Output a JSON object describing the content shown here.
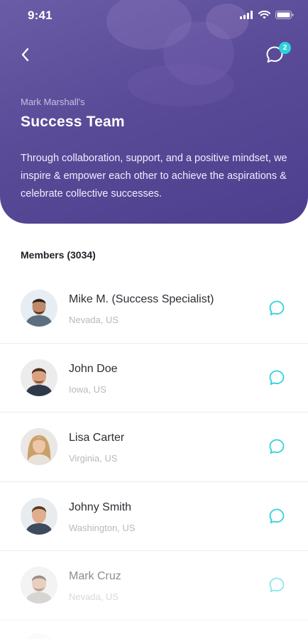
{
  "status_bar": {
    "time": "9:41"
  },
  "header": {
    "notification_count": "2",
    "owner_label": "Mark Marshall's",
    "title": "Success Team",
    "description": "Through collaboration, support, and a positive mindset, we inspire & empower each other to achieve the aspirations & celebrate collective successes."
  },
  "members": {
    "heading": "Members (3034)",
    "items": [
      {
        "name": "Mike M. (Success Specialist)",
        "location": "Nevada, US"
      },
      {
        "name": "John Doe",
        "location": "Iowa, US"
      },
      {
        "name": "Lisa Carter",
        "location": "Virginia, US"
      },
      {
        "name": "Johny Smith",
        "location": "Washington, US"
      },
      {
        "name": "Mark Cruz",
        "location": "Nevada, US"
      }
    ]
  },
  "colors": {
    "header_bg": "#5a4b98",
    "accent": "#2dd3d8",
    "divider": "#ececf1"
  },
  "icons": {
    "back": "chevron-left-icon",
    "chat": "chat-bubble-icon",
    "message": "message-icon"
  }
}
